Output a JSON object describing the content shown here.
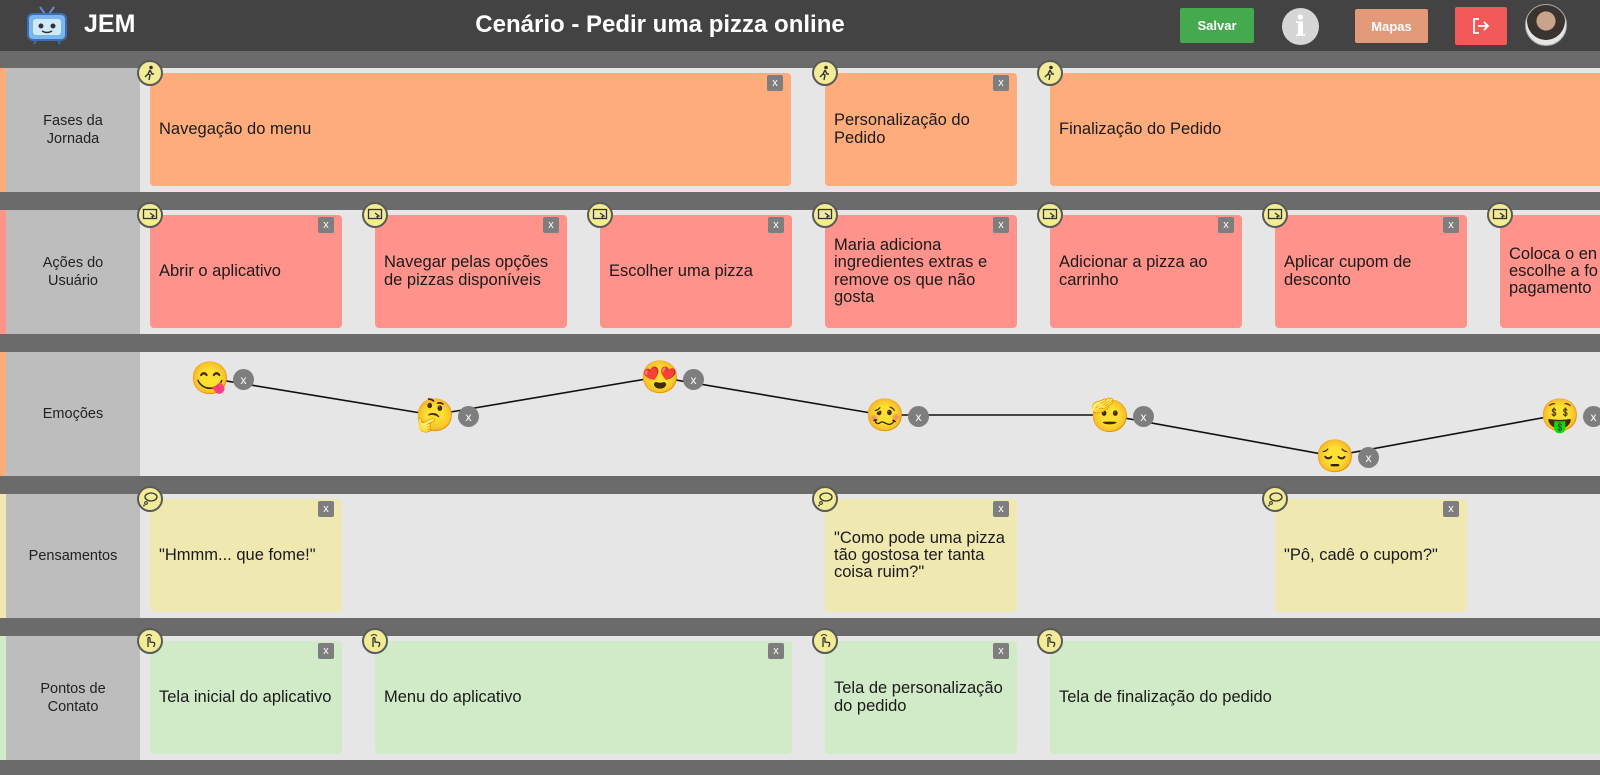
{
  "app": {
    "brand": "JEM",
    "title": "Cenário - Pedir uma pizza online"
  },
  "toolbar": {
    "save_label": "Salvar",
    "info_label": "i",
    "maps_label": "Mapas"
  },
  "rows": {
    "phases": {
      "label": "Fases da\nJornada",
      "color": "#ffac7c",
      "cards": [
        "Navegação do menu",
        "Personalização do Pedido",
        "Finalização do Pedido"
      ]
    },
    "actions": {
      "label": "Ações do\nUsuário",
      "color": "#ff928a",
      "cards": [
        "Abrir o aplicativo",
        "Navegar pelas opções de pizzas disponíveis",
        "Escolher uma pizza",
        "Maria adiciona ingredientes extras e remove os que não gosta",
        "Adicionar a pizza ao carrinho",
        "Aplicar cupom de desconto",
        "Coloca o en escolhe a fo pagamento"
      ]
    },
    "emotions": {
      "label": "Emoções",
      "color": "#ffac7c",
      "items": [
        {
          "emoji": "😋",
          "name": "yum-face-emoji"
        },
        {
          "emoji": "🤔",
          "name": "thinking-face-emoji"
        },
        {
          "emoji": "😍",
          "name": "heart-eyes-emoji"
        },
        {
          "emoji": "🥴",
          "name": "woozy-face-emoji"
        },
        {
          "emoji": "🫡",
          "name": "saluting-face-emoji"
        },
        {
          "emoji": "😔",
          "name": "pensive-face-emoji"
        },
        {
          "emoji": "🤑",
          "name": "money-mouth-face-emoji"
        }
      ]
    },
    "thoughts": {
      "label": "Pensamentos",
      "color": "#efe8b1",
      "cards": [
        "\"Hmmm... que fome!\"",
        "\"Como pode uma pizza tão gostosa ter tanta coisa ruim?\"",
        "\"Pô, cadê o cupom?\""
      ]
    },
    "contacts": {
      "label": "Pontos de\nContato",
      "color": "#d1eac7",
      "cards": [
        "Tela inicial do aplicativo",
        "Menu do aplicativo",
        "Tela de personalização do pedido",
        "Tela de finalização do pedido"
      ]
    }
  },
  "close_label": "x",
  "icons": {
    "phase": "walking-person-icon",
    "action": "screen-pointer-icon",
    "thought": "thought-bubble-icon",
    "contact": "touch-hand-icon",
    "logout": "logout-icon",
    "logo": "tv-robot-logo-icon"
  }
}
